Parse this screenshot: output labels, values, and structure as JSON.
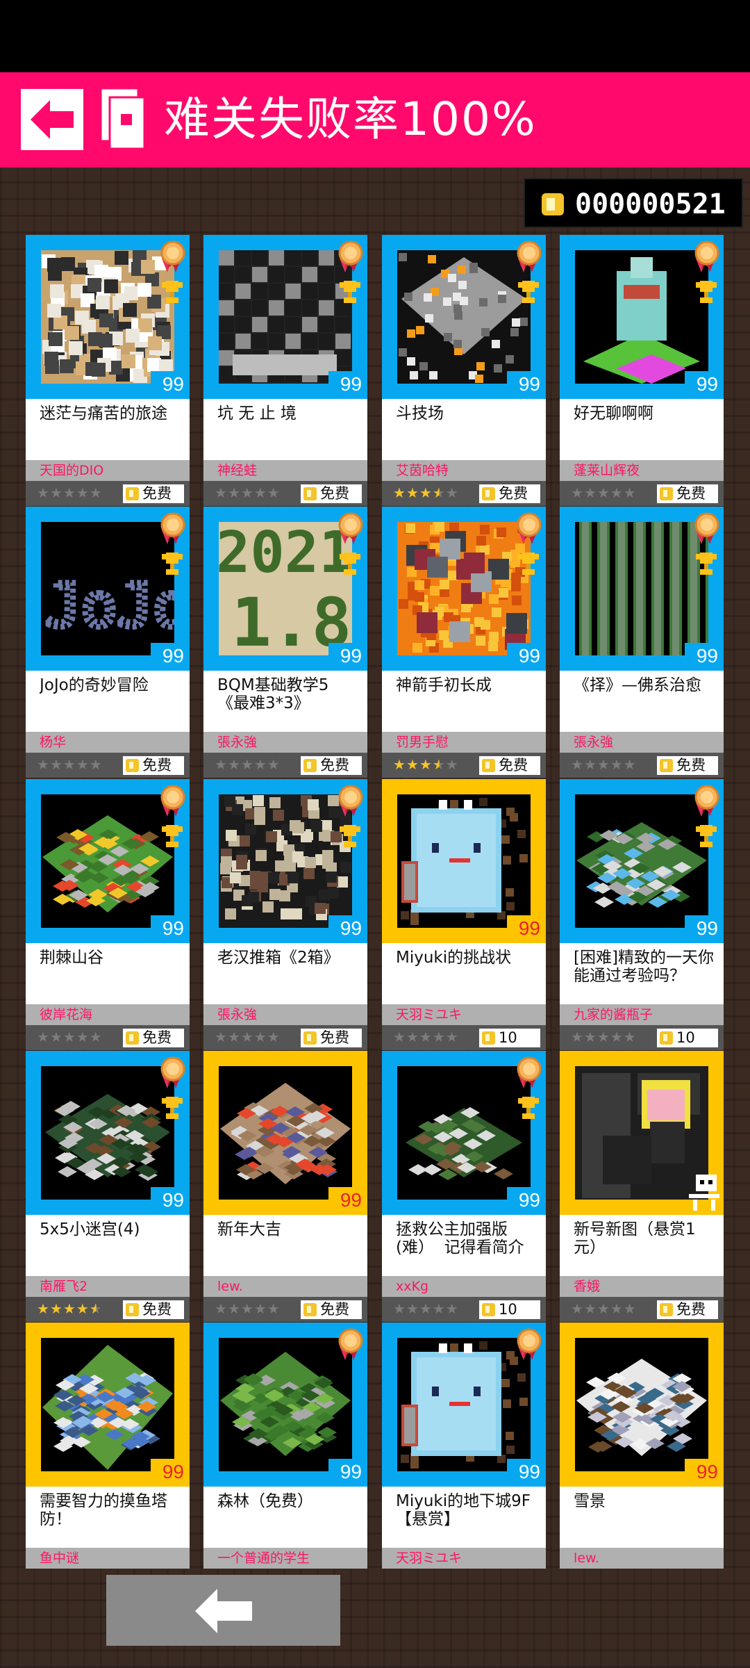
{
  "header": {
    "title": "难关失败率100%"
  },
  "coins": {
    "value": "000000521"
  },
  "colors": {
    "header_bg": "#ff0a6c",
    "frame_blue": "#08a8f0",
    "frame_yellow": "#ffc400",
    "author_pink": "#ff1466",
    "star_gold": "#f4c42a",
    "star_gray": "#7c7c7c"
  },
  "cards": [
    {
      "name": "迷茫与痛苦的旅途",
      "author": "天国的DIO",
      "difficulty": "99",
      "frame": "blue",
      "medal": true,
      "trophy": true,
      "rating": 0,
      "price": "免费",
      "thumb": "maze_white"
    },
    {
      "name": "坑 无 止 境",
      "author": "神经蛙",
      "difficulty": "99",
      "frame": "blue",
      "medal": true,
      "trophy": true,
      "rating": 0,
      "price": "免费",
      "thumb": "pit"
    },
    {
      "name": "斗技场",
      "author": "艾茵哈特",
      "difficulty": "99",
      "frame": "blue",
      "medal": true,
      "trophy": true,
      "rating": 3.5,
      "price": "免费",
      "thumb": "arena"
    },
    {
      "name": "好无聊啊啊",
      "author": "蓬莱山辉夜",
      "difficulty": "99",
      "frame": "blue",
      "medal": true,
      "trophy": true,
      "rating": 0,
      "price": "免费",
      "thumb": "statue"
    },
    {
      "name": "JoJo的奇妙冒险",
      "author": "杨华",
      "difficulty": "99",
      "frame": "blue",
      "medal": true,
      "trophy": true,
      "rating": 0,
      "price": "免费",
      "thumb": "jojo"
    },
    {
      "name": "BQM基础教学5《最难3*3》",
      "author": "張永強",
      "difficulty": "99",
      "frame": "blue",
      "medal": true,
      "trophy": true,
      "rating": 0,
      "price": "免费",
      "thumb": "date"
    },
    {
      "name": "神箭手初长成",
      "author": "罚男手慰",
      "difficulty": "99",
      "frame": "blue",
      "medal": true,
      "trophy": true,
      "rating": 3.5,
      "price": "免费",
      "thumb": "lava"
    },
    {
      "name": "《择》—佛系治愈",
      "author": "張永強",
      "difficulty": "99",
      "frame": "blue",
      "medal": true,
      "trophy": true,
      "rating": 0,
      "price": "免费",
      "thumb": "columns"
    },
    {
      "name": "荆棘山谷",
      "author": "彼岸花海",
      "difficulty": "99",
      "frame": "blue",
      "medal": true,
      "trophy": true,
      "rating": 0,
      "price": "免费",
      "thumb": "valley"
    },
    {
      "name": "老汉推箱《2箱》",
      "author": "張永強",
      "difficulty": "99",
      "frame": "blue",
      "medal": true,
      "trophy": true,
      "rating": 0,
      "price": "免费",
      "thumb": "boxmaze"
    },
    {
      "name": "Miyuki的挑战状",
      "author": "天羽ミユキ",
      "difficulty": "99",
      "frame": "yellow",
      "medal": false,
      "trophy": false,
      "rating": 0,
      "price": "10",
      "thumb": "ghost"
    },
    {
      "name": "[困难]精致的一天你能通过考验吗？",
      "author": "九家的酱瓶子",
      "difficulty": "99",
      "frame": "blue",
      "medal": true,
      "trophy": true,
      "rating": 0,
      "price": "10",
      "thumb": "castle"
    },
    {
      "name": "5x5小迷宫(4)",
      "author": "南雁飞2",
      "difficulty": "99",
      "frame": "blue",
      "medal": true,
      "trophy": true,
      "rating": 4.5,
      "price": "免费",
      "thumb": "smallmaze"
    },
    {
      "name": "新年大吉",
      "author": "lew.",
      "difficulty": "99",
      "frame": "yellow",
      "medal": false,
      "trophy": false,
      "rating": 0,
      "price": "免费",
      "thumb": "newyear"
    },
    {
      "name": "拯救公主加强版(难）  记得看简介",
      "author": "xxKg",
      "difficulty": "99",
      "frame": "blue",
      "medal": true,
      "trophy": true,
      "rating": 0,
      "price": "10",
      "thumb": "princess"
    },
    {
      "name": "新号新图（悬赏1元）",
      "author": "香娥",
      "difficulty": "",
      "frame": "yellow",
      "medal": false,
      "trophy": false,
      "rating": 0,
      "price": "免费",
      "thumb": "knight",
      "skull": true
    },
    {
      "name": "需要智力的摸鱼塔防！",
      "author": "鱼中谜",
      "difficulty": "99",
      "frame": "yellow",
      "medal": false,
      "trophy": false,
      "rating": null,
      "price": "",
      "thumb": "tower"
    },
    {
      "name": "森林（免费）",
      "author": "一个普通的学生",
      "difficulty": "99",
      "frame": "blue",
      "medal": true,
      "trophy": false,
      "rating": null,
      "price": "",
      "thumb": "forest"
    },
    {
      "name": "Miyuki的地下城9F【悬赏】",
      "author": "天羽ミユキ",
      "difficulty": "99",
      "frame": "blue",
      "medal": true,
      "trophy": false,
      "rating": null,
      "price": "",
      "thumb": "ghost"
    },
    {
      "name": "雪景",
      "author": "lew.",
      "difficulty": "99",
      "frame": "yellow",
      "medal": false,
      "trophy": false,
      "rating": null,
      "price": "",
      "thumb": "snow"
    }
  ]
}
